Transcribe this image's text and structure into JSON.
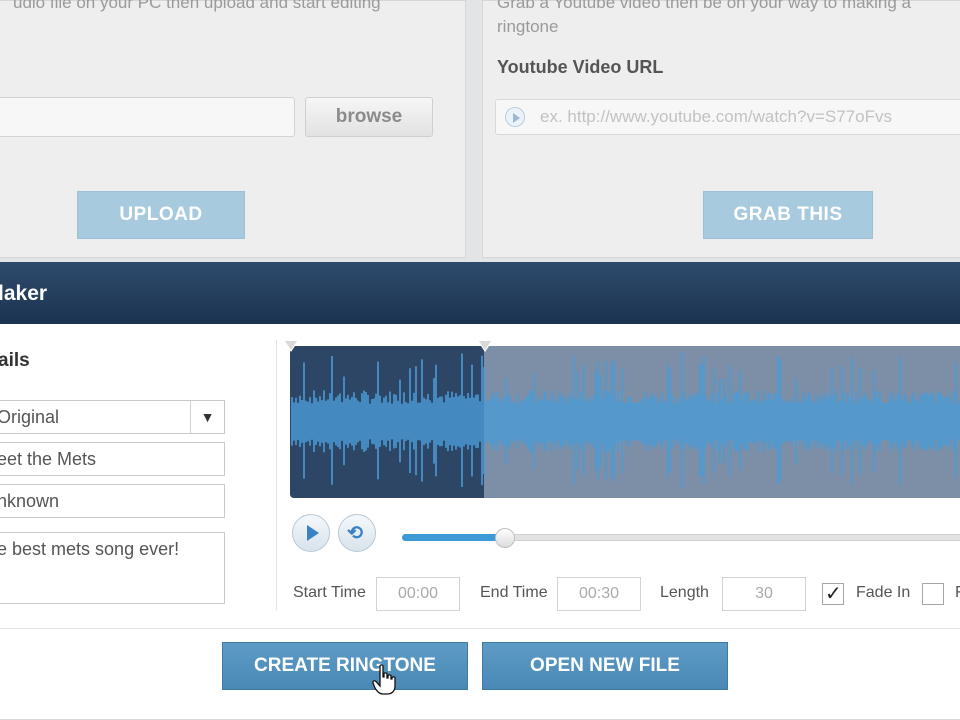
{
  "upload": {
    "description": "udio file on your PC then upload and start editing",
    "browse_label": "browse",
    "upload_label": "UPLOAD"
  },
  "youtube": {
    "description": "Grab a Youtube video then be on your way to making a ringtone",
    "url_label": "Youtube Video URL",
    "url_placeholder": "ex. http://www.youtube.com/watch?v=S77oFvs",
    "grab_label": "GRAB THIS"
  },
  "maker": {
    "title": "laker",
    "details_title": "ails",
    "format_value": "Original",
    "title_value": "eet the Mets",
    "artist_value": "nknown",
    "description_value": "e best mets song ever!",
    "selection_fraction": 0.285,
    "progress_fraction": 0.18,
    "start_time_label": "Start Time",
    "start_time_value": "00:00",
    "end_time_label": "End Time",
    "end_time_value": "00:30",
    "length_label": "Length",
    "length_value": "30",
    "fade_in_label": "Fade In",
    "fade_in_checked": true,
    "fade_out_checked": false,
    "fade_out_label_fragment": "F",
    "create_label": "CREATE RINGTONE",
    "open_label": "OPEN NEW FILE"
  },
  "icons": {
    "play": "play-icon",
    "loop": "loop-icon",
    "dropdown": "dropdown-arrow-icon",
    "url": "play-circle-icon",
    "cursor": "hand-cursor-icon"
  },
  "colors": {
    "header": "#223b5a",
    "waveform": "#4a9ad6",
    "selected_region": "#2d4665",
    "primary_button": "#4f8dbb",
    "disabled_button": "#a8cade"
  }
}
